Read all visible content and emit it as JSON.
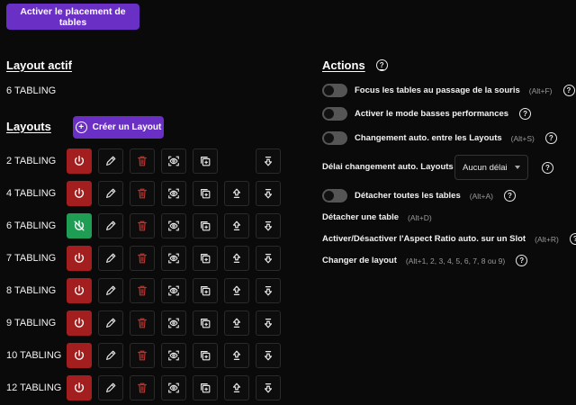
{
  "top_button": {
    "label": "Activer le placement de tables"
  },
  "active_layout": {
    "heading": "Layout actif",
    "value": "6 TABLING"
  },
  "layouts": {
    "heading": "Layouts",
    "create_label": "Créer un Layout",
    "rows": [
      {
        "name": "2 TABLING",
        "power": "off",
        "has_up": false
      },
      {
        "name": "4 TABLING",
        "power": "off",
        "has_up": true
      },
      {
        "name": "6 TABLING",
        "power": "on",
        "has_up": true
      },
      {
        "name": "7 TABLING",
        "power": "off",
        "has_up": true
      },
      {
        "name": "8 TABLING",
        "power": "off",
        "has_up": true
      },
      {
        "name": "9 TABLING",
        "power": "off",
        "has_up": true
      },
      {
        "name": "10 TABLING",
        "power": "off",
        "has_up": true
      },
      {
        "name": "12 TABLING",
        "power": "off",
        "has_up": true
      }
    ]
  },
  "actions": {
    "heading": "Actions",
    "focus": {
      "label": "Focus les tables au passage de la souris",
      "shortcut": "(Alt+F)"
    },
    "low_perf": {
      "label": "Activer le mode basses performances",
      "shortcut": ""
    },
    "auto_change": {
      "label": "Changement auto. entre les Layouts",
      "shortcut": "(Alt+S)"
    },
    "delay": {
      "label": "Délai changement auto. Layouts",
      "value": "Aucun délai"
    },
    "detach_all": {
      "label": "Détacher toutes les tables",
      "shortcut": "(Alt+A)"
    },
    "detach_one": {
      "label": "Détacher une table",
      "shortcut": "(Alt+D)"
    },
    "aspect": {
      "label": "Activer/Désactiver l'Aspect Ratio auto. sur un Slot",
      "shortcut": "(Alt+R)"
    },
    "change_layout": {
      "label": "Changer de layout",
      "shortcut": "(Alt+1, 2, 3, 4, 5, 6, 7, 8 ou 9)"
    }
  },
  "colors": {
    "accent": "#6a2fc4",
    "power_off": "#a31e1e",
    "power_on": "#1f9d55",
    "delete": "#c0302a"
  }
}
